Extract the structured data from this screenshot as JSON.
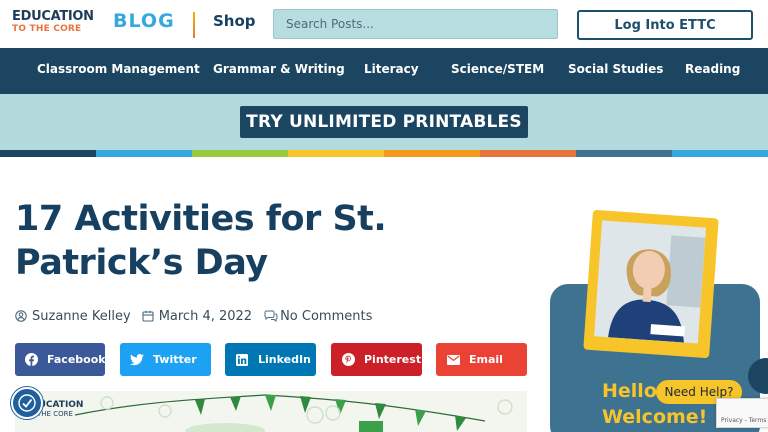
{
  "header": {
    "logo_top": "EDUCATION",
    "logo_bottom": "TO THE CORE",
    "blog_label": "BLOG",
    "shop_label": "Shop",
    "search_placeholder": "Search Posts...",
    "login_label": "Log Into ETTC"
  },
  "nav": {
    "items": [
      "Classroom Management",
      "Grammar & Writing",
      "Literacy",
      "Science/STEM",
      "Social Studies",
      "Reading"
    ]
  },
  "promo": {
    "label": "TRY UNLIMITED PRINTABLES"
  },
  "stripe_colors": [
    "#1b4560",
    "#35a8e0",
    "#9bc93c",
    "#f7c52a",
    "#f39a1d",
    "#e8743b",
    "#3d7390",
    "#35a8e0"
  ],
  "article": {
    "title": "17 Activities for St. Patrick’s Day",
    "author": "Suzanne Kelley",
    "date": "March 4, 2022",
    "comments": "No Comments",
    "icons": [
      "user-icon",
      "calendar-icon",
      "comments-icon"
    ]
  },
  "share": [
    {
      "label": "Facebook",
      "icon": "facebook-icon",
      "color": "#3b5998"
    },
    {
      "label": "Twitter",
      "icon": "twitter-icon",
      "color": "#1da1f2"
    },
    {
      "label": "LinkedIn",
      "icon": "linkedin-icon",
      "color": "#0077b5"
    },
    {
      "label": "Pinterest",
      "icon": "pinterest-icon",
      "color": "#cb2027"
    },
    {
      "label": "Email",
      "icon": "email-icon",
      "color": "#ea4335"
    }
  ],
  "hero_image": {
    "logo_top": "EDUCATION",
    "logo_bottom": "TO THE CORE"
  },
  "sidebar": {
    "greeting_line1": "Hello",
    "greeting_line2": "Welcome!"
  },
  "widgets": {
    "chat_label": "Need Help?",
    "recaptcha_text": "Privacy - Terms"
  },
  "colors": {
    "navy": "#1b4560",
    "teal_light": "#b3dbdd",
    "accent_blue": "#35a8e0",
    "accent_yellow": "#f7c52a"
  }
}
